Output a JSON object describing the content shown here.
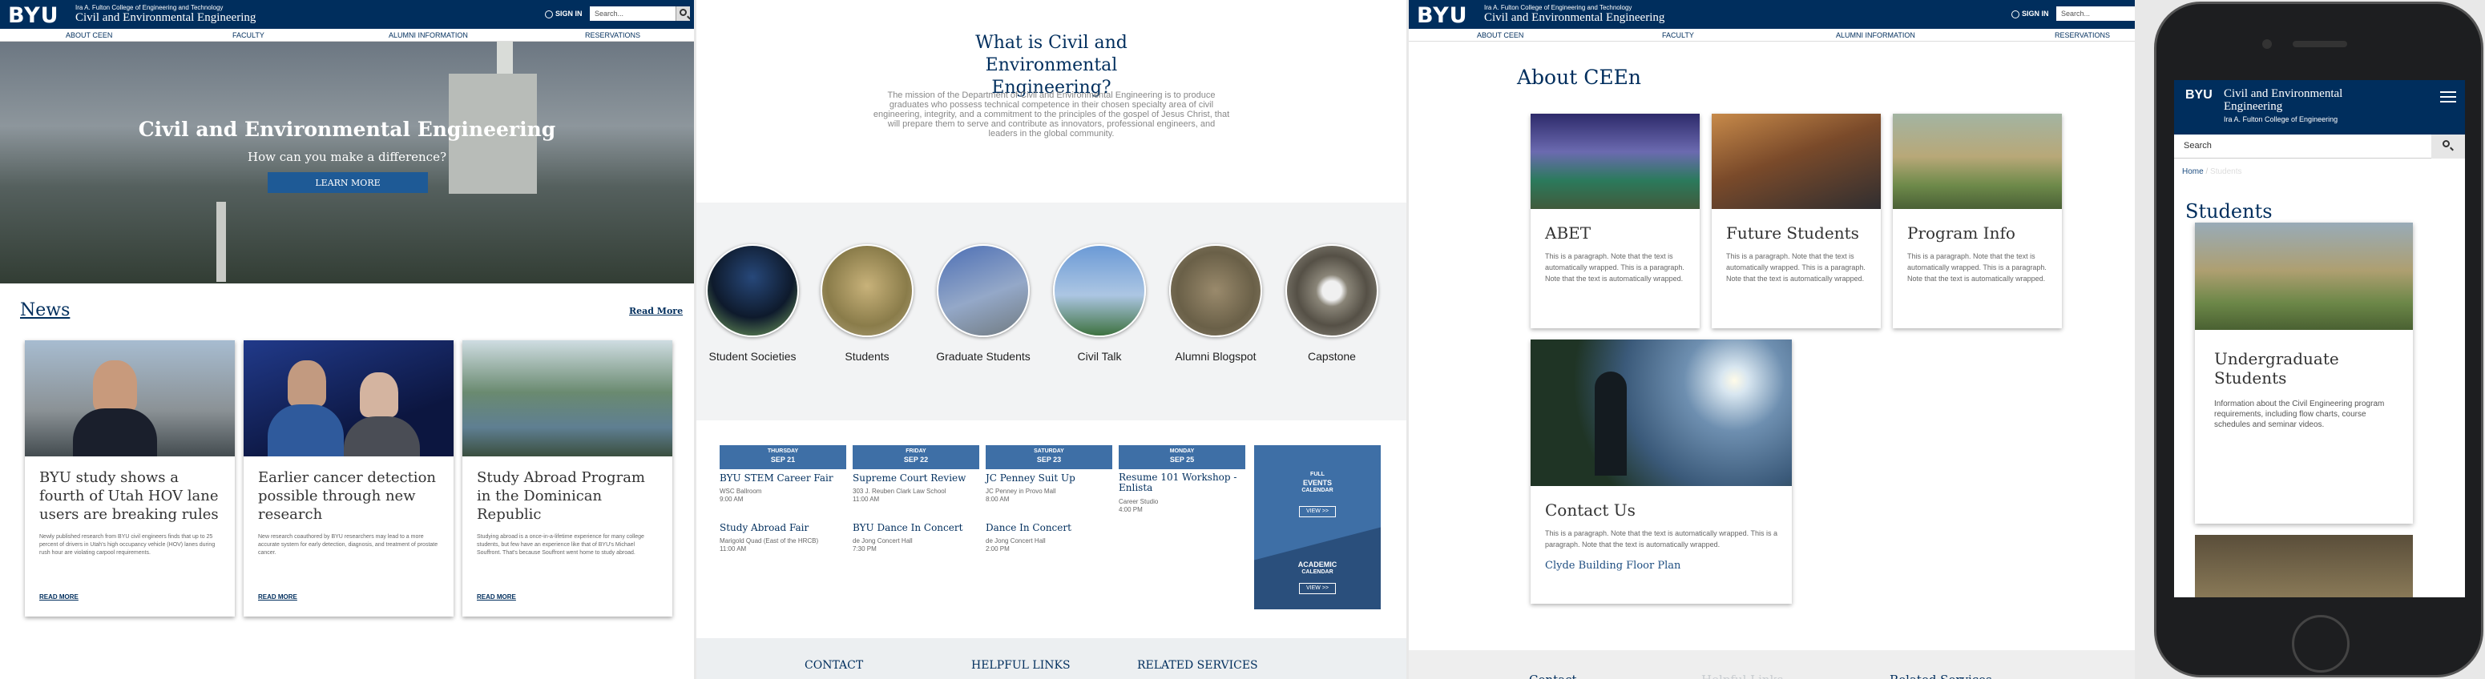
{
  "site": {
    "logo": "BYU",
    "college": "Ira A. Fulton College of Engineering and Technology",
    "dept": "Civil and Environmental Engineering",
    "sign_in": "SIGN IN",
    "search_placeholder": "Search..."
  },
  "nav": [
    "ABOUT CEEN",
    "FACULTY",
    "ALUMNI INFORMATION",
    "RESERVATIONS"
  ],
  "hero": {
    "title": "Civil and Environmental Engineering",
    "subtitle": "How can you make a difference?",
    "button": "LEARN MORE"
  },
  "news": {
    "heading": "News",
    "read_more": "Read More",
    "items": [
      {
        "title": "BYU study shows a fourth of Utah HOV lane users are breaking rules",
        "text": "Newly published research from BYU civil engineers finds that up to 25 percent of drivers in Utah's high occupancy vehicle (HOV) lanes during rush hour are violating carpool requirements.",
        "link": "READ MORE"
      },
      {
        "title": "Earlier cancer detection possible through new research",
        "text": "New research coauthored by BYU researchers may lead to a more accurate system for early detection, diagnosis, and treatment of prostate cancer.",
        "link": "READ MORE"
      },
      {
        "title": "Study Abroad Program in the Dominican Republic",
        "text": "Studying abroad is a once-in-a-lifetime experience for many college students, but few have an experience like that of BYU's Michael Souffront. That's because Souffront went home to study abroad.",
        "link": "READ MORE"
      }
    ]
  },
  "mission": {
    "title": "What is Civil and Environmental Engineering?",
    "text": "The mission of the Department of Civil and Environmental Engineering is to produce graduates who possess technical competence in their chosen specialty area of civil engineering, integrity, and a commitment to the principles of the gospel of Jesus Christ, that will prepare them to serve and contribute as innovators, professional engineers, and leaders in the global community."
  },
  "circles": [
    "Student Societies",
    "Students",
    "Graduate Students",
    "Civil Talk",
    "Alumni Blogspot",
    "Capstone"
  ],
  "events": {
    "days": [
      {
        "day": "THURSDAY",
        "date": "SEP 21",
        "items": [
          {
            "t": "BYU STEM Career Fair",
            "s": "WSC Ballroom",
            "s2": "9:00 AM"
          },
          {
            "t": "Study Abroad Fair",
            "s": "Marigold Quad (East of the HRCB)",
            "s2": "11:00 AM"
          }
        ]
      },
      {
        "day": "FRIDAY",
        "date": "SEP 22",
        "items": [
          {
            "t": "Supreme Court Review",
            "s": "303 J. Reuben Clark Law School",
            "s2": "11:00 AM"
          },
          {
            "t": "BYU Dance In Concert",
            "s": "de Jong Concert Hall",
            "s2": "7:30 PM"
          }
        ]
      },
      {
        "day": "SATURDAY",
        "date": "SEP 23",
        "items": [
          {
            "t": "JC Penney Suit Up",
            "s": "JC Penney in Provo Mall",
            "s2": "8:00 AM"
          },
          {
            "t": "Dance In Concert",
            "s": "de Jong Concert Hall",
            "s2": "2:00 PM"
          }
        ]
      },
      {
        "day": "MONDAY",
        "date": "SEP 25",
        "items": [
          {
            "t": "Resume 101 Workshop - Enlista",
            "s": "Career Studio",
            "s2": "4:00 PM"
          }
        ]
      }
    ],
    "full": "FULL",
    "full2": "EVENTS",
    "cal": "CALENDAR",
    "view": "VIEW >>",
    "acad": "ACADEMIC",
    "acad_cal": "CALENDAR",
    "acad_view": "VIEW >>"
  },
  "footer": [
    "CONTACT",
    "HELPFUL LINKS",
    "RELATED SERVICES"
  ],
  "about": {
    "title": "About CEEn",
    "tiles": [
      {
        "title": "ABET",
        "text": "This is a paragraph. Note that the text is automatically wrapped. This is a paragraph. Note that the text is automatically wrapped."
      },
      {
        "title": "Future Students",
        "text": "This is a paragraph. Note that the text is automatically wrapped. This is a paragraph. Note that the text is automatically wrapped."
      },
      {
        "title": "Program Info",
        "text": "This is a paragraph. Note that the text is automatically wrapped. This is a paragraph. Note that the text is automatically wrapped."
      }
    ],
    "contact": {
      "title": "Contact Us",
      "text": "This is a paragraph. Note that the text is automatically wrapped. This is a paragraph. Note that the text is automatically wrapped.",
      "link": "Clyde Building Floor Plan"
    }
  },
  "footer3": [
    "Contact",
    "Helpful Links",
    "Related Services"
  ],
  "mobile": {
    "dept": "Civil and Environmental Engineering",
    "college": "Ira A. Fulton College of Engineering",
    "search": "Search",
    "crumb_home": "Home",
    "crumb_current": "Students",
    "title": "Students",
    "card_title": "Undergraduate Students",
    "card_text": "Information about the Civil Engineering program requirements, including flow charts, course schedules and seminar videos."
  }
}
